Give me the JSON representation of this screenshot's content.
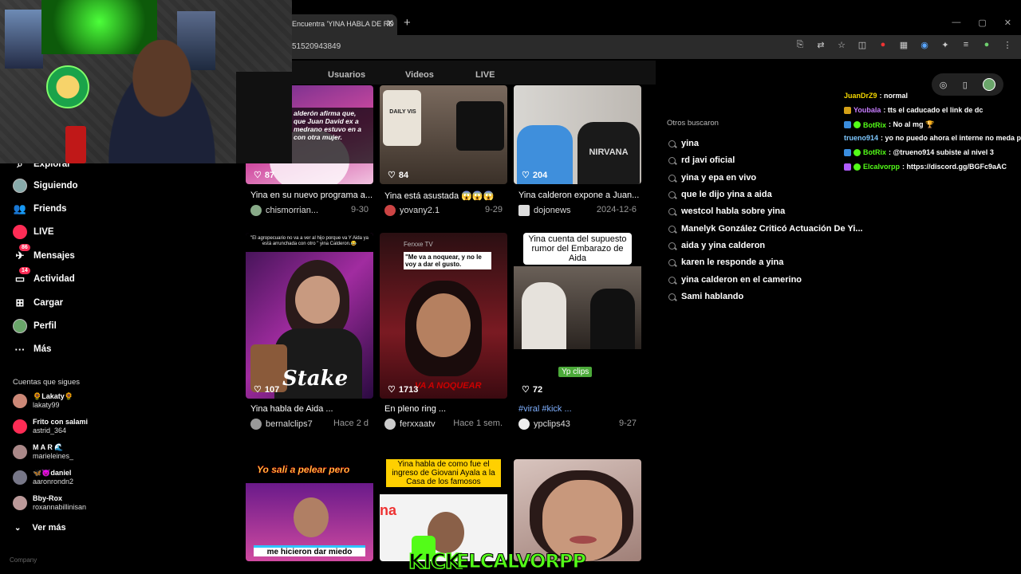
{
  "browser": {
    "tab_title": "Encuentra 'YINA HABLA DE RD",
    "tab_close": "✕",
    "new_tab": "+",
    "url": "51520943849"
  },
  "nav": {
    "items": [
      {
        "label": "Explorar",
        "icon": "explore-icon"
      },
      {
        "label": "Siguiendo",
        "icon": "following-icon"
      },
      {
        "label": "Friends",
        "icon": "friends-icon"
      },
      {
        "label": "LIVE",
        "icon": "live-icon"
      },
      {
        "label": "Mensajes",
        "icon": "messages-icon",
        "badge": "86"
      },
      {
        "label": "Actividad",
        "icon": "activity-icon",
        "badge": "14"
      },
      {
        "label": "Cargar",
        "icon": "upload-icon"
      },
      {
        "label": "Perfil",
        "icon": "profile-icon"
      },
      {
        "label": "Más",
        "icon": "more-icon"
      }
    ],
    "following_title": "Cuentas que sigues",
    "accounts": [
      {
        "name": "🌻Lakaty🌻",
        "user": "lakaty99"
      },
      {
        "name": "Frito con salami",
        "user": "astrid_364"
      },
      {
        "name": "M A R 🌊",
        "user": "marieleines_"
      },
      {
        "name": "🦋😈daniel",
        "user": "aaronrondn2"
      },
      {
        "name": "Bby-Rox",
        "user": "roxannabillinisan"
      }
    ],
    "see_more": "Ver más",
    "company": "Company"
  },
  "search_tabs": [
    "Usuarios",
    "Videos",
    "LIVE"
  ],
  "videos": [
    {
      "likes": "87",
      "title": "Yina en su nuevo programa a...",
      "author": "chismorrian...",
      "date": "9-30",
      "overlay": "alderón afirma que, que Juan David ex a medrano estuvo en a con otra mujer."
    },
    {
      "likes": "84",
      "title": "Yina está asustada 😱😱😱",
      "author": "yovany2.1",
      "date": "9-29",
      "overlay": "DAILY VIS"
    },
    {
      "likes": "204",
      "title": "Yina calderon expone a Juan...",
      "author": "dojonews",
      "date": "2024-12-6",
      "overlay": "NIRVANA"
    },
    {
      "likes": "107",
      "title": "Yina habla de Aida ...",
      "author": "bernalclips7",
      "date": "Hace 2 d",
      "overlay": "\"El agropecuario no va a ver al hijo porque va Y Aida ya está arrunchada con otro \" yina Calderon.😂",
      "overlay2": "Stake"
    },
    {
      "likes": "1713",
      "title": "En pleno ring ...",
      "author": "ferxxaatv",
      "date": "Hace 1 sem.",
      "overlay": "\"Me va a noquear, y no le voy a dar el gusto.",
      "overlay2": "Ferxxe TV",
      "overlay3": "VA A NOQUEAR"
    },
    {
      "likes": "72",
      "title": "#viral #kick ...",
      "author": "ypclips43",
      "date": "9-27",
      "overlay": "Yina cuenta del supuesto rumor del Embarazo de Aida",
      "overlay2": "Yp clips"
    },
    {
      "likes": "",
      "title": "",
      "author": "",
      "date": "",
      "overlay": "Yo sali a pelear pero",
      "overlay2": "me hicieron dar miedo"
    },
    {
      "likes": "",
      "title": "",
      "author": "",
      "date": "",
      "overlay": "Yina habla de como fue el ingreso de Giovani Ayala a la Casa de los famosos"
    },
    {
      "likes": "",
      "title": "",
      "author": "",
      "date": "",
      "overlay": ""
    }
  ],
  "others": {
    "title": "Otros buscaron",
    "items": [
      "yina",
      "rd javi oficial",
      "yina y epa en vivo",
      "que le dijo yina a aida",
      "westcol habla sobre yina",
      "Manelyk González Criticó Actuación De Yi...",
      "aida y yina calderon",
      "karen le responde a yina",
      "yina calderon en el camerino",
      "Sami hablando"
    ]
  },
  "chat": [
    {
      "user": "JuanDrZ9",
      "color": "#f5d800",
      "msg": ": normal",
      "badges": []
    },
    {
      "user": "Youbala",
      "color": "#c77dff",
      "msg": ": tts el caducado el link de dc",
      "badges": [
        "#d4a017"
      ]
    },
    {
      "user": "BotRix",
      "color": "#53fc18",
      "msg": ": No al mg 🏆",
      "badges": [
        "#3a8dde",
        "#53fc18"
      ]
    },
    {
      "user": "trueno914",
      "color": "#7ec8ff",
      "msg": ": yo no puedo ahora el interne no meda p",
      "badges": []
    },
    {
      "user": "BotRix",
      "color": "#53fc18",
      "msg": ": @trueno914 subiste al nivel 3",
      "badges": [
        "#3a8dde",
        "#53fc18"
      ]
    },
    {
      "user": "Elcalvorpp",
      "color": "#53fc18",
      "msg": ": https://discord.gg/BGFc9aAC",
      "badges": [
        "#b05cff",
        "#53fc18"
      ]
    }
  ],
  "watermark": {
    "kick": "KICK",
    "name": "ELCALVORPP"
  },
  "colors": {
    "accent": "#fe2c55",
    "kick_green": "#53fc18"
  }
}
